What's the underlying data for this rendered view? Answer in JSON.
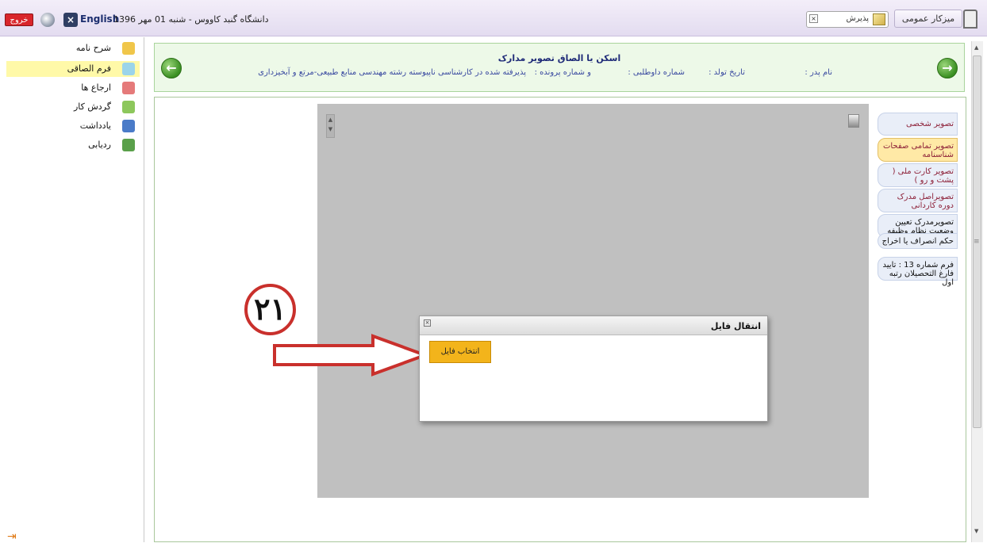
{
  "header": {
    "exit_label": "خروج",
    "lang_label": "English",
    "info": "دانشگاه گنبد کاووس - شنبه 01 مهر 1396",
    "search_label": "پذیرش",
    "workspace_label": "میزکار عمومی"
  },
  "sidebar": {
    "items": [
      {
        "label": "شرح نامه",
        "color": "#f0c64a"
      },
      {
        "label": "فرم الصاقی",
        "color": "#9bd4ea"
      },
      {
        "label": "ارجاع ها",
        "color": "#e57a7a"
      },
      {
        "label": "گردش کار",
        "color": "#8dc75c"
      },
      {
        "label": "یادداشت",
        "color": "#4a7bc8"
      },
      {
        "label": "ردیابی",
        "color": "#5aa04a"
      }
    ],
    "active_index": 1
  },
  "panel": {
    "title": "اسکن یا الصاق تصویر مدارک",
    "father_name": "نام پدر :",
    "birth_date": "تاریخ تولد :",
    "applicant_no": "شماره داوطلبی :",
    "file_no": "و شماره پرونده :",
    "admission": "پذیرفته شده در کارشناسی ناپیوسته رشته مهندسی منابع طبیعی-مرتع و آبخیزداری"
  },
  "tabs": [
    {
      "label": "تصویر شخصی"
    },
    {
      "label": "تصویر تمامی صفحات شناسنامه"
    },
    {
      "label": "تصویر کارت ملی ( پشت و رو )"
    },
    {
      "label": "تصویراصل مدرک دوره کاردانی"
    },
    {
      "label": "تصویرمدرک تعیین وضعیت نظام وظیفه"
    },
    {
      "label": "حکم انصراف یا اخراج"
    },
    {
      "label": "فرم شماره 13 : تایید فارغ التحصیلان رتبه اول"
    }
  ],
  "dialog": {
    "title": "انتقال فایل",
    "button_label": "انتخاب فایل"
  },
  "annotation": {
    "step": "۲۱",
    "color": "#c9302c"
  }
}
